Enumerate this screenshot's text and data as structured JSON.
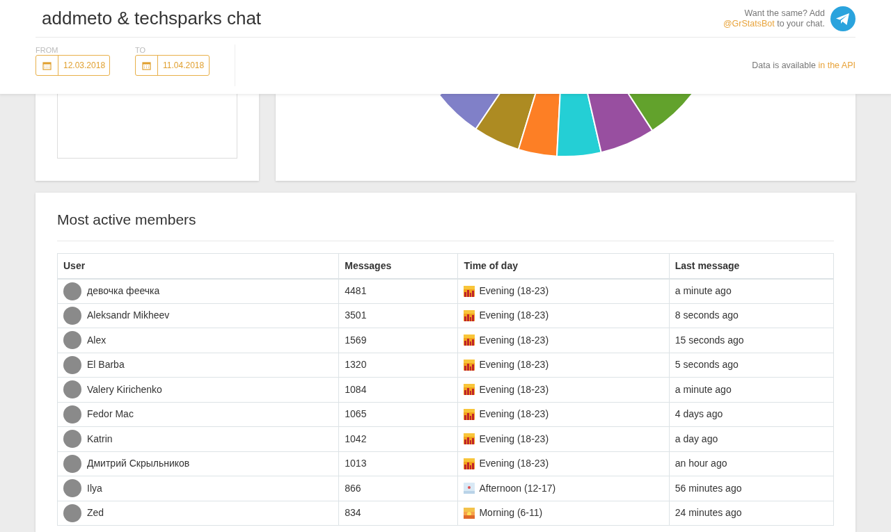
{
  "header": {
    "title": "addmeto & techsparks chat",
    "promo_text": "Want the same? Add",
    "promo_link": "@GrStatsBot",
    "promo_suffix": "to your chat.",
    "from_label": "FROM",
    "from_date": "12.03.2018",
    "to_label": "TO",
    "to_date": "11.04.2018",
    "api_text": "Data is available",
    "api_link": "in the API"
  },
  "members": {
    "title": "Most active members",
    "columns": [
      "User",
      "Messages",
      "Time of day",
      "Last message"
    ],
    "rows": [
      {
        "user": "девочка феечка",
        "messages": "4481",
        "kind": "evening",
        "time": "Evening (18-23)",
        "last": "a minute ago"
      },
      {
        "user": "Aleksandr Mikheev",
        "messages": "3501",
        "kind": "evening",
        "time": "Evening (18-23)",
        "last": "8 seconds ago"
      },
      {
        "user": "Alex",
        "messages": "1569",
        "kind": "evening",
        "time": "Evening (18-23)",
        "last": "15 seconds ago"
      },
      {
        "user": "El Barba",
        "messages": "1320",
        "kind": "evening",
        "time": "Evening (18-23)",
        "last": "5 seconds ago"
      },
      {
        "user": "Valery Kirichenko",
        "messages": "1084",
        "kind": "evening",
        "time": "Evening (18-23)",
        "last": "a minute ago"
      },
      {
        "user": "Fedor Mac",
        "messages": "1065",
        "kind": "evening",
        "time": "Evening (18-23)",
        "last": "4 days ago"
      },
      {
        "user": "Katrin",
        "messages": "1042",
        "kind": "evening",
        "time": "Evening (18-23)",
        "last": "a day ago"
      },
      {
        "user": "Дмитрий Скрыльников",
        "messages": "1013",
        "kind": "evening",
        "time": "Evening (18-23)",
        "last": "an hour ago"
      },
      {
        "user": "Ilya",
        "messages": "866",
        "kind": "afternoon",
        "time": "Afternoon (12-17)",
        "last": "56 minutes ago"
      },
      {
        "user": "Zed",
        "messages": "834",
        "kind": "morning",
        "time": "Morning (6-11)",
        "last": "24 minutes ago"
      }
    ]
  }
}
